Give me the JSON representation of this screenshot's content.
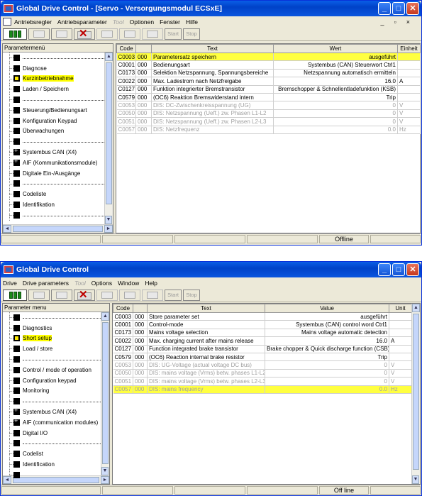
{
  "top": {
    "title": "Global Drive Control - [Servo - Versorgungsmodul ECSxE]",
    "menu": [
      "Antriebsregler",
      "Antriebsparameter",
      "Tool",
      "Optionen",
      "Fenster",
      "Hilfe"
    ],
    "toolbar": {
      "start": "Start",
      "stop": "Stop"
    },
    "tree_header": "Parametermenü",
    "tree": [
      {
        "label": "",
        "type": "sep"
      },
      {
        "label": "Diagnose",
        "type": "item"
      },
      {
        "label": "Kurzinbetriebnahme",
        "type": "item",
        "selected": true,
        "icon": "open"
      },
      {
        "label": "Laden / Speichern",
        "type": "item"
      },
      {
        "label": "",
        "type": "sep"
      },
      {
        "label": "Steuerung/Bedienungsart",
        "type": "item"
      },
      {
        "label": "Konfiguration Keypad",
        "type": "item"
      },
      {
        "label": "Überwachungen",
        "type": "item"
      },
      {
        "label": "",
        "type": "sep"
      },
      {
        "label": "Systembus CAN (X4)",
        "type": "item",
        "icon": "plus"
      },
      {
        "label": "AIF (Kommunikationsmodule)",
        "type": "item",
        "icon": "plus"
      },
      {
        "label": "Digitale Ein-/Ausgänge",
        "type": "item"
      },
      {
        "label": "",
        "type": "sep"
      },
      {
        "label": "Codeliste",
        "type": "item"
      },
      {
        "label": "Identifikation",
        "type": "item"
      },
      {
        "label": "",
        "type": "sep"
      }
    ],
    "columns": [
      "Code",
      "",
      "Text",
      "Wert",
      "Einheit"
    ],
    "rows": [
      {
        "code": "C0003",
        "sub": "000",
        "text": "Parametersatz speichern",
        "value": "ausgeführt",
        "unit": "",
        "hl": true
      },
      {
        "code": "C0001",
        "sub": "000",
        "text": "Bedienungsart",
        "value": "Systembus (CAN) Steuerwort Ctrl1",
        "unit": ""
      },
      {
        "code": "C0173",
        "sub": "000",
        "text": "Selektion Netzspannung, Spannungsbereiche",
        "value": "Netzspannung automatisch ermitteln",
        "unit": ""
      },
      {
        "code": "C0022",
        "sub": "000",
        "text": "Max. Ladestrom nach Netzfreigabe",
        "value": "16.0",
        "unit": "A"
      },
      {
        "code": "C0127",
        "sub": "000",
        "text": "Funktion integrierter Bremstransistor",
        "value": "Bremschopper & Schnellentladefunktion (KSB)",
        "unit": ""
      },
      {
        "code": "C0579",
        "sub": "000",
        "text": "(OC6) Reaktion  Bremswiderstand intern",
        "value": "Trip",
        "unit": ""
      },
      {
        "code": "C0053",
        "sub": "000",
        "text": "DIS: DC-Zwischenkreisspannung (UG)",
        "value": "0",
        "unit": "V",
        "dim": true
      },
      {
        "code": "C0050",
        "sub": "000",
        "text": "DIS: Netzspannung (Ueff.) zw. Phasen L1-L2",
        "value": "0",
        "unit": "V",
        "dim": true
      },
      {
        "code": "C0051",
        "sub": "000",
        "text": "DIS: Netzspannung (Ueff.) zw. Phasen L2-L3",
        "value": "0",
        "unit": "V",
        "dim": true
      },
      {
        "code": "C0057",
        "sub": "000",
        "text": "DIS: Netzfrequenz",
        "value": "0.0",
        "unit": "Hz",
        "dim": true
      }
    ],
    "status": "Offline"
  },
  "bottom": {
    "title": "Global Drive Control",
    "menu": [
      "Drive",
      "Drive parameters",
      "Tool",
      "Options",
      "Window",
      "Help"
    ],
    "toolbar": {
      "start": "Start",
      "stop": "Stop"
    },
    "tree_header": "Parameter menu",
    "tree": [
      {
        "label": "",
        "type": "sep"
      },
      {
        "label": "Diagnostics",
        "type": "item"
      },
      {
        "label": "Short setup",
        "type": "item",
        "selected": true,
        "icon": "open"
      },
      {
        "label": "Load / store",
        "type": "item"
      },
      {
        "label": "",
        "type": "sep"
      },
      {
        "label": "Control / mode of operation",
        "type": "item"
      },
      {
        "label": "Configuration keypad",
        "type": "item"
      },
      {
        "label": "Monitoring",
        "type": "item"
      },
      {
        "label": "",
        "type": "sep"
      },
      {
        "label": "Systembus CAN (X4)",
        "type": "item",
        "icon": "plus"
      },
      {
        "label": "AIF (communication modules)",
        "type": "item",
        "icon": "plus"
      },
      {
        "label": "Digital I/O",
        "type": "item"
      },
      {
        "label": "",
        "type": "sep"
      },
      {
        "label": "Codelist",
        "type": "item"
      },
      {
        "label": "Identification",
        "type": "item"
      },
      {
        "label": "",
        "type": "sep"
      }
    ],
    "columns": [
      "Code",
      "",
      "Text",
      "Value",
      "Unit"
    ],
    "rows": [
      {
        "code": "C0003",
        "sub": "000",
        "text": "Store parameter set",
        "value": "ausgeführt",
        "unit": ""
      },
      {
        "code": "C0001",
        "sub": "000",
        "text": "Control-mode",
        "value": "Systembus (CAN) control word Ctrl1",
        "unit": ""
      },
      {
        "code": "C0173",
        "sub": "000",
        "text": "Mains voltage selection",
        "value": "Mains voltage automatic detection",
        "unit": ""
      },
      {
        "code": "C0022",
        "sub": "000",
        "text": "Max. charging current after mains release",
        "value": "16.0",
        "unit": "A"
      },
      {
        "code": "C0127",
        "sub": "000",
        "text": "Function integrated brake transistor",
        "value": "Brake chopper & Quick discharge function (CSB)",
        "unit": ""
      },
      {
        "code": "C0579",
        "sub": "000",
        "text": "(OC6) Reaction  internal brake resistor",
        "value": "Trip",
        "unit": ""
      },
      {
        "code": "C0053",
        "sub": "000",
        "text": "DIS: UG-Voltage (actual voltage DC bus)",
        "value": "0",
        "unit": "V",
        "dim": true
      },
      {
        "code": "C0050",
        "sub": "000",
        "text": "DIS: mains voltage (Vrms) betw. phases L1-L2",
        "value": "0",
        "unit": "V",
        "dim": true
      },
      {
        "code": "C0051",
        "sub": "000",
        "text": "DIS: mains voltage (Vrms) betw. phases L2-L3",
        "value": "0",
        "unit": "V",
        "dim": true
      },
      {
        "code": "C0057",
        "sub": "000",
        "text": "DIS: mains frequency",
        "value": "0.0",
        "unit": "Hz",
        "dim": true,
        "hl": true
      }
    ],
    "status": "Off line"
  }
}
